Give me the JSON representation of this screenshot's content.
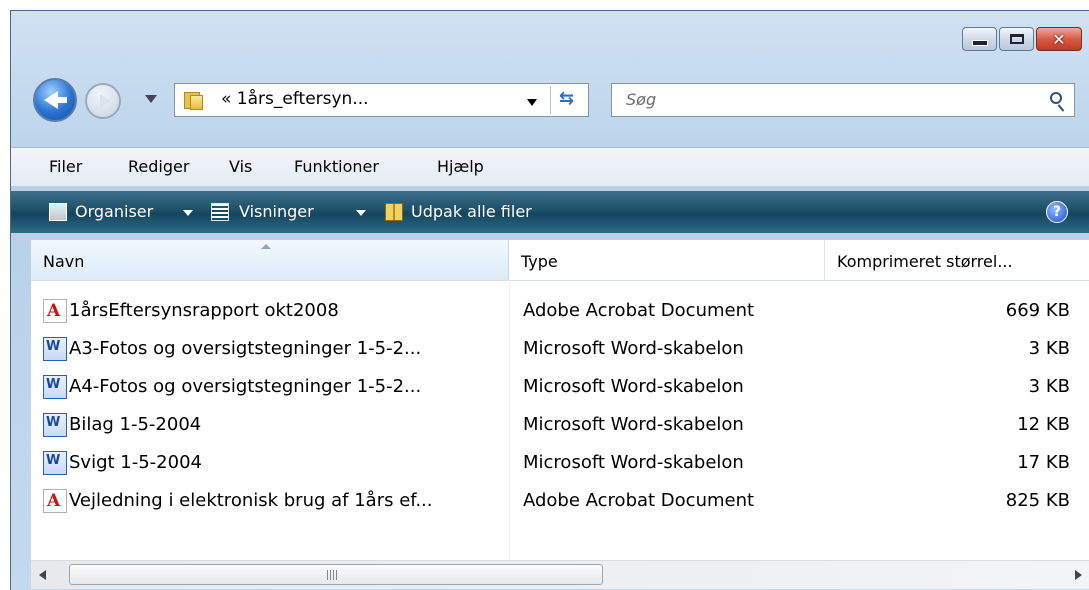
{
  "window": {
    "address": "« 1års_eftersyn...",
    "search_placeholder": "Søg",
    "refresh_glyph": "⁴↑",
    "help_glyph": "?"
  },
  "menu": [
    "Filer",
    "Rediger",
    "Vis",
    "Funktioner",
    "Hjælp"
  ],
  "commands": {
    "organise": "Organiser",
    "views": "Visninger",
    "extract": "Udpak alle filer"
  },
  "columns": {
    "name": "Navn",
    "type": "Type",
    "size": "Komprimeret størrel..."
  },
  "files": [
    {
      "name": "1årsEftersynsrapport okt2008",
      "type": "Adobe Acrobat Document",
      "size": "669 KB",
      "icon": "pdf-icon"
    },
    {
      "name": "A3-Fotos og oversigtstegninger 1-5-2...",
      "type": "Microsoft Word-skabelon",
      "size": "3 KB",
      "icon": "word-icon"
    },
    {
      "name": "A4-Fotos og oversigtstegninger 1-5-2...",
      "type": "Microsoft Word-skabelon",
      "size": "3 KB",
      "icon": "word-icon"
    },
    {
      "name": "Bilag 1-5-2004",
      "type": "Microsoft Word-skabelon",
      "size": "12 KB",
      "icon": "word-icon"
    },
    {
      "name": "Svigt 1-5-2004",
      "type": "Microsoft Word-skabelon",
      "size": "17 KB",
      "icon": "word-icon"
    },
    {
      "name": "Vejledning i elektronisk brug af 1års ef...",
      "type": "Adobe Acrobat Document",
      "size": "825 KB",
      "icon": "pdf-icon"
    }
  ],
  "scrollbar": {
    "grip_glyph": "III"
  }
}
